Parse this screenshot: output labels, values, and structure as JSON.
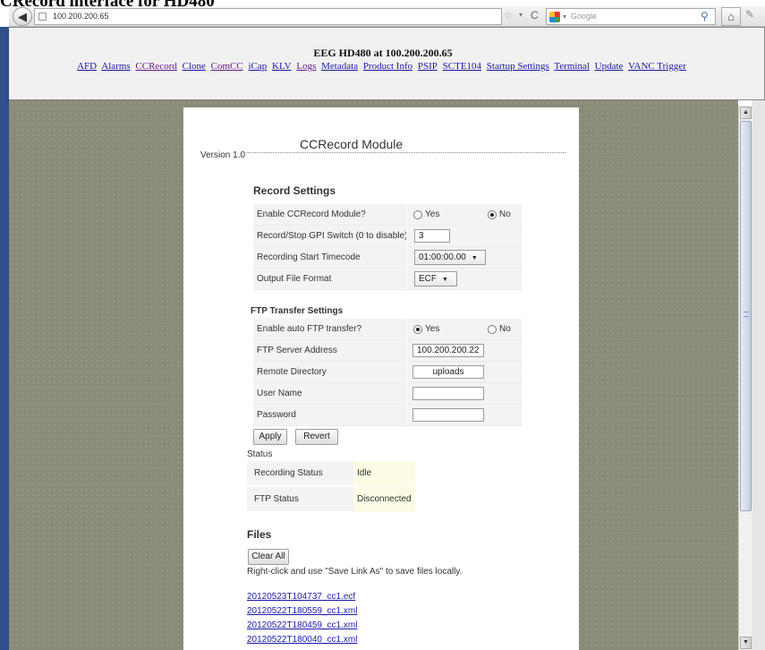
{
  "page_caption": "CRecord interface for HD480",
  "browser": {
    "back_symbol": "◀",
    "url": "100.200.200.65",
    "search_placeholder": "Google",
    "icons": {
      "star": "☆",
      "dropdown": "▾",
      "reload": "C",
      "search": "⚲",
      "home": "⌂",
      "bookmark": "✎"
    }
  },
  "header": {
    "title": "EEG HD480 at 100.200.200.65",
    "nav": [
      {
        "label": "AFD"
      },
      {
        "label": "Alarms"
      },
      {
        "label": "CCRecord"
      },
      {
        "label": "Clone"
      },
      {
        "label": "ComCC"
      },
      {
        "label": "iCap"
      },
      {
        "label": "KLV"
      },
      {
        "label": "Logs"
      },
      {
        "label": "Metadata"
      },
      {
        "label": "Product Info"
      },
      {
        "label": "PSIP"
      },
      {
        "label": "SCTE104"
      },
      {
        "label": "Startup Settings"
      },
      {
        "label": "Terminal"
      },
      {
        "label": "Update"
      },
      {
        "label": "VANC Trigger"
      }
    ]
  },
  "module": {
    "title": "CCRecord Module",
    "version": "Version 1.0",
    "record_settings": {
      "heading": "Record Settings",
      "enable_label": "Enable CCRecord Module?",
      "enable_yes": "Yes",
      "enable_no": "No",
      "enable_value": "No",
      "gpi_label": "Record/Stop GPI Switch (0 to disable)",
      "gpi_value": "3",
      "timecode_label": "Recording Start Timecode",
      "timecode_value": "01:00:00.00",
      "format_label": "Output File Format",
      "format_value": "ECF"
    },
    "ftp_settings": {
      "heading": "FTP Transfer Settings",
      "auto_label": "Enable auto FTP transfer?",
      "auto_yes": "Yes",
      "auto_no": "No",
      "auto_value": "Yes",
      "server_label": "FTP Server Address",
      "server_value": "100.200.200.22",
      "dir_label": "Remote Directory",
      "dir_value": "uploads",
      "user_label": "User Name",
      "user_value": "",
      "password_label": "Password",
      "password_value": ""
    },
    "buttons": {
      "apply": "Apply",
      "revert": "Revert",
      "clear_all": "Clear All"
    },
    "status": {
      "heading": "Status",
      "recording_label": "Recording Status",
      "recording_value": "Idle",
      "ftp_label": "FTP Status",
      "ftp_value": "Disconnected"
    },
    "files": {
      "heading": "Files",
      "help": "Right-click and use \"Save Link As\" to save files locally.",
      "list": [
        "20120523T104737_cc1.ecf",
        "20120522T180559_cc1.xml",
        "20120522T180459_cc1.xml",
        "20120522T180040_cc1.xml"
      ]
    }
  }
}
